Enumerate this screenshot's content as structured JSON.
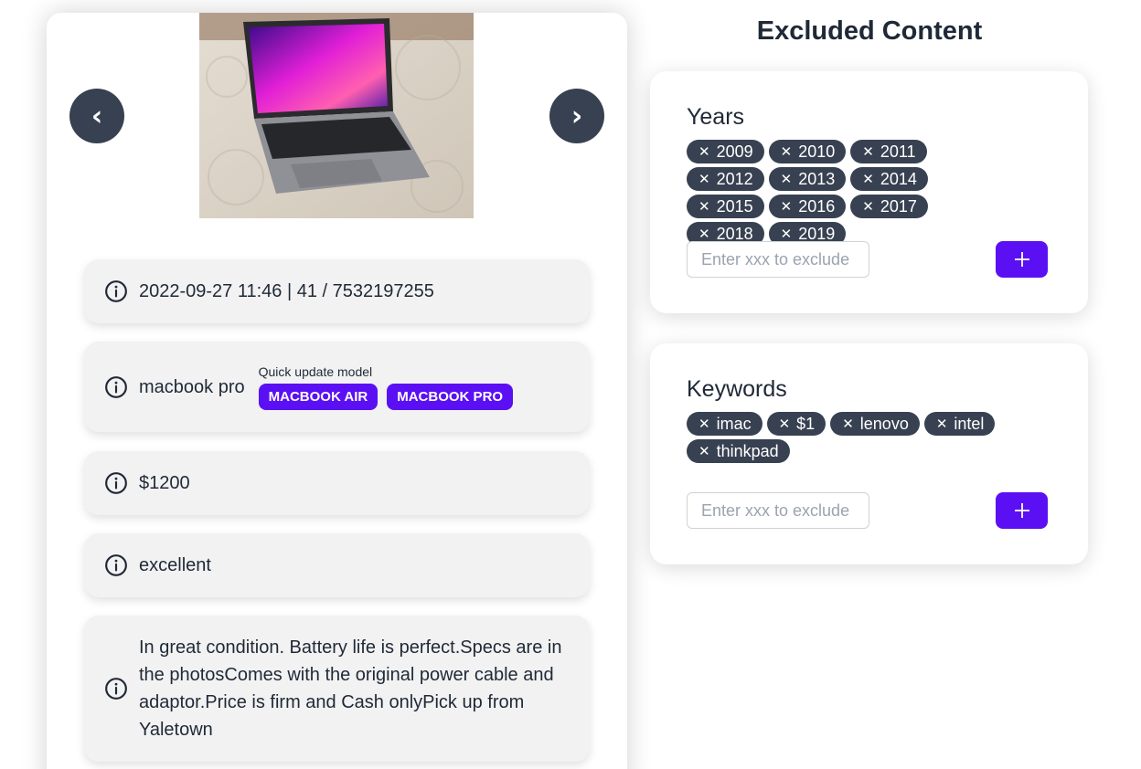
{
  "listing": {
    "prev_label": "‹",
    "next_label": "›",
    "meta": "2022-09-27 11:46 | 41 / 7532197255",
    "model": "macbook pro",
    "quick_update_caption": "Quick update model",
    "quick_update_options": [
      "MACBOOK AIR",
      "MACBOOK PRO"
    ],
    "price": "$1200",
    "condition": "excellent",
    "description": "In great condition. Battery life is perfect.Specs are in the photosComes with the original power cable and adaptor.Price is firm and Cash onlyPick up from Yaletown"
  },
  "excluded": {
    "title": "Excluded Content",
    "years": {
      "heading": "Years",
      "chips": [
        "2009",
        "2010",
        "2011",
        "2012",
        "2013",
        "2014",
        "2015",
        "2016",
        "2017",
        "2018",
        "2019"
      ],
      "input_placeholder": "Enter xxx to exclude"
    },
    "keywords": {
      "heading": "Keywords",
      "chips": [
        "imac",
        "$1",
        "lenovo",
        "intel",
        "thinkpad"
      ],
      "input_placeholder": "Enter xxx to exclude"
    },
    "chip_remove_glyph": "✕"
  },
  "colors": {
    "accent": "#5b10f3",
    "chip_bg": "#374151",
    "row_bg": "#f2f2f2"
  },
  "icons": [
    "chevron-left-icon",
    "chevron-right-icon",
    "info-icon",
    "close-icon",
    "plus-icon"
  ]
}
